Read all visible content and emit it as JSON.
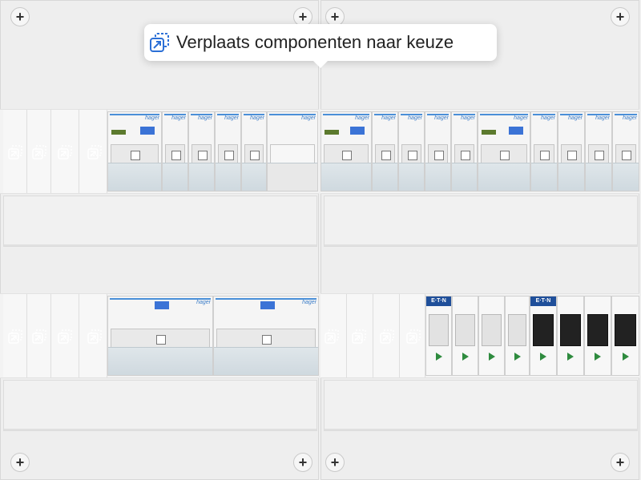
{
  "tooltip": {
    "text": "Verplaats componenten naar keuze",
    "icon": "move-component-icon"
  },
  "panel_icons": {
    "screw": "plus-screw-icon",
    "slot": "move-slot-icon"
  },
  "brands": {
    "hager": "hager",
    "eaton": "E·T·N"
  },
  "colors": {
    "accent_blue": "#3b73d6",
    "hager_blue": "#4a8fd8",
    "eaton_blue": "#1f4f9a",
    "arrow_green": "#2e8b3e"
  }
}
